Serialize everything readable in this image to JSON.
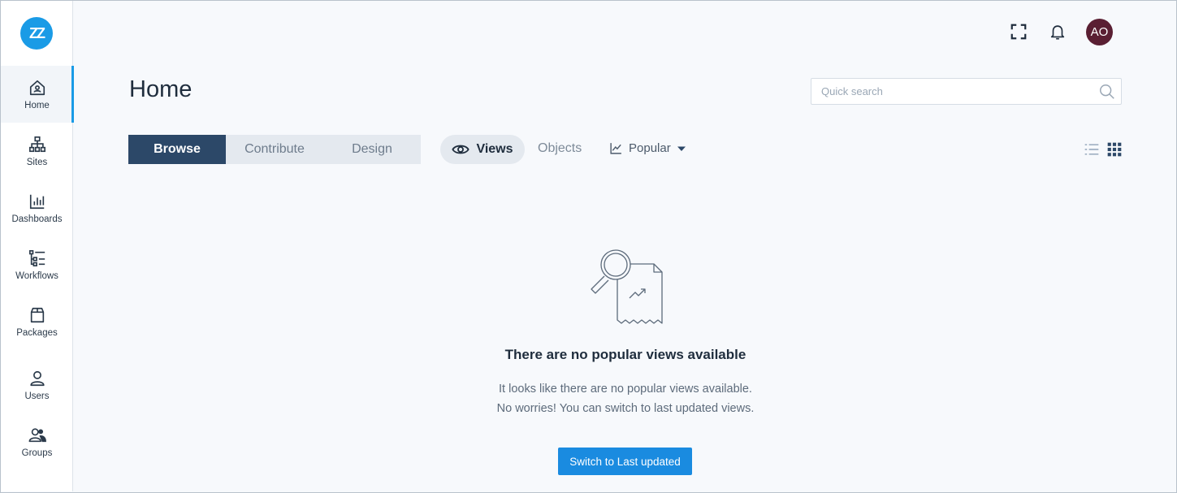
{
  "logo": {
    "text": "ZZ"
  },
  "sidebar": {
    "items": [
      {
        "label": "Home",
        "icon": "home-icon",
        "active": true
      },
      {
        "label": "Sites",
        "icon": "sitemap-icon",
        "active": false
      },
      {
        "label": "Dashboards",
        "icon": "bar-chart-icon",
        "active": false
      },
      {
        "label": "Workflows",
        "icon": "workflow-icon",
        "active": false
      },
      {
        "label": "Packages",
        "icon": "package-icon",
        "active": false
      },
      {
        "label": "Users",
        "icon": "user-icon",
        "active": false
      },
      {
        "label": "Groups",
        "icon": "users-group-icon",
        "active": false
      }
    ]
  },
  "topbar": {
    "avatar_initials": "AO",
    "avatar_color": "#5a1f33"
  },
  "page": {
    "title": "Home"
  },
  "search": {
    "placeholder": "Quick search",
    "value": ""
  },
  "mode_tabs": [
    {
      "label": "Browse",
      "active": true
    },
    {
      "label": "Contribute",
      "active": false
    },
    {
      "label": "Design",
      "active": false
    }
  ],
  "content_tabs": {
    "views_label": "Views",
    "objects_label": "Objects"
  },
  "sort": {
    "selected": "Popular"
  },
  "empty_state": {
    "title": "There are no popular views available",
    "line1": "It looks like there are no popular views available.",
    "line2": "No worries! You can switch to last updated views.",
    "button_label": "Switch to Last updated"
  },
  "colors": {
    "accent": "#1a9be6",
    "primary_button": "#1a8be0",
    "active_tab": "#2c4868"
  }
}
